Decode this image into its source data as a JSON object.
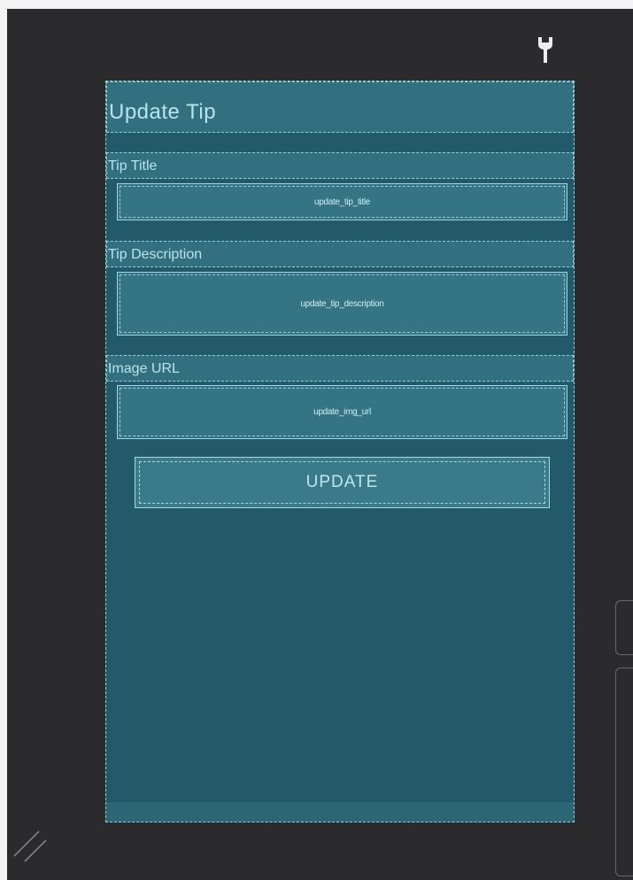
{
  "screen": {
    "title": "Update Tip",
    "fields": [
      {
        "label": "Tip Title",
        "id_text": "update_tip_title"
      },
      {
        "label": "Tip Description",
        "id_text": "update_tip_description"
      },
      {
        "label": "Image URL",
        "id_text": "update_img_url"
      }
    ],
    "button_label": "UPDATE"
  },
  "icons": {
    "toolbar": "wrench-icon",
    "corner": "resize-handle-icon"
  },
  "colors": {
    "canvas_background": "#2b2b2d",
    "device_background": "#235a69",
    "blueprint_outline": "#8fd0de",
    "text": "#b8e3ec"
  }
}
